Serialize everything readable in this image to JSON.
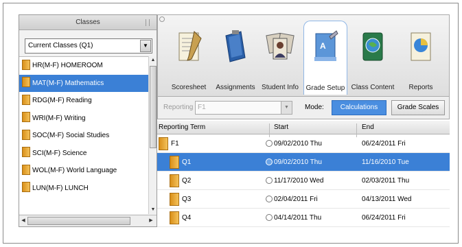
{
  "left_panel": {
    "title": "Classes",
    "class_select": "Current Classes (Q1)",
    "classes": [
      {
        "label": "HR(M-F) HOMEROOM",
        "selected": false
      },
      {
        "label": "MAT(M-F) Mathematics",
        "selected": true
      },
      {
        "label": "RDG(M-F) Reading",
        "selected": false
      },
      {
        "label": "WRI(M-F) Writing",
        "selected": false
      },
      {
        "label": "SOC(M-F) Social Studies",
        "selected": false
      },
      {
        "label": "SCI(M-F) Science",
        "selected": false
      },
      {
        "label": "WOL(M-F) World Language",
        "selected": false
      },
      {
        "label": "LUN(M-F) LUNCH",
        "selected": false
      }
    ]
  },
  "toolbar": {
    "tools": [
      {
        "label": "Scoresheet",
        "icon": "scoresheet-icon",
        "active": false
      },
      {
        "label": "Assignments",
        "icon": "assignments-icon",
        "active": false
      },
      {
        "label": "Student Info",
        "icon": "student-info-icon",
        "active": false
      },
      {
        "label": "Grade Setup",
        "icon": "grade-setup-icon",
        "active": true
      },
      {
        "label": "Class Content",
        "icon": "class-content-icon",
        "active": false
      },
      {
        "label": "Reports",
        "icon": "reports-icon",
        "active": false
      }
    ]
  },
  "subbar": {
    "reporting_term_label": "Reporting Term:",
    "reporting_term_value": "F1",
    "mode_label": "Mode:",
    "calculations_label": "Calculations",
    "grade_scales_label": "Grade Scales"
  },
  "grid": {
    "headers": [
      "Reporting Term",
      "Start",
      "End"
    ],
    "rows": [
      {
        "term": "F1",
        "start": "09/02/2010 Thu",
        "end": "06/24/2011 Fri",
        "selected": false,
        "indent": false
      },
      {
        "term": "Q1",
        "start": "09/02/2010 Thu",
        "end": "11/16/2010 Tue",
        "selected": true,
        "indent": true
      },
      {
        "term": "Q2",
        "start": "11/17/2010 Wed",
        "end": "02/03/2011 Thu",
        "selected": false,
        "indent": true
      },
      {
        "term": "Q3",
        "start": "02/04/2011 Fri",
        "end": "04/13/2011 Wed",
        "selected": false,
        "indent": true
      },
      {
        "term": "Q4",
        "start": "04/14/2011 Thu",
        "end": "06/24/2011 Fri",
        "selected": false,
        "indent": true
      }
    ]
  },
  "colors": {
    "selection": "#3b80d6",
    "folder": "#f0b040"
  }
}
